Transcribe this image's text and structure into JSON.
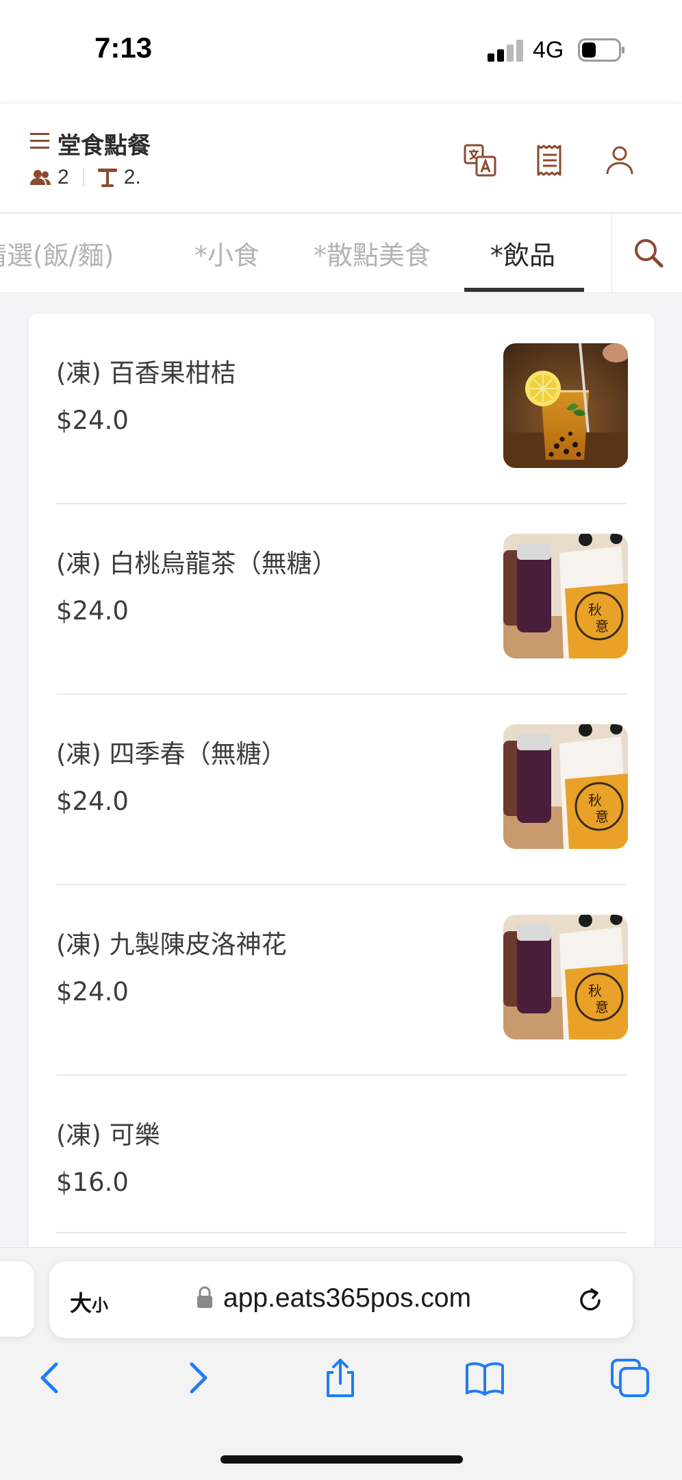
{
  "status_bar": {
    "time": "7:13",
    "network": "4G",
    "signal_bars": 4,
    "signal_bars_filled": 2
  },
  "header": {
    "title": "堂食點餐",
    "guests": "2",
    "table": "2.",
    "icons": [
      "menu-icon",
      "people-icon",
      "table-icon",
      "translate-icon",
      "receipt-icon",
      "user-icon"
    ],
    "accent_color": "#8b4a2e"
  },
  "tabs": {
    "items": [
      {
        "label": "精選(飯/麵)",
        "active": false
      },
      {
        "label": "*小食",
        "active": false
      },
      {
        "label": "*散點美食",
        "active": false
      },
      {
        "label": "*飲品",
        "active": true
      }
    ],
    "search_icon": "search-icon"
  },
  "menu": {
    "items": [
      {
        "name": "(凍) 百香果柑桔",
        "price": "$24.0",
        "has_image": true
      },
      {
        "name": "(凍) 白桃烏龍茶（無糖）",
        "price": "$24.0",
        "has_image": true
      },
      {
        "name": "(凍) 四季春（無糖）",
        "price": "$24.0",
        "has_image": true
      },
      {
        "name": "(凍) 九製陳皮洛神花",
        "price": "$24.0",
        "has_image": true
      },
      {
        "name": "(凍) 可樂",
        "price": "$16.0",
        "has_image": false
      }
    ]
  },
  "browser": {
    "text_size_label": "大",
    "text_size_small": "小",
    "url": "app.eats365pos.com",
    "toolbar_icons": [
      "back-icon",
      "forward-icon",
      "share-icon",
      "bookmarks-icon",
      "tabs-icon"
    ],
    "link_color": "#1f7cf6"
  }
}
